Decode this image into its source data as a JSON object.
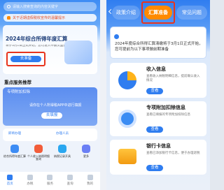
{
  "left": {
    "search_placeholder": "请输入搜索查询的内容关键字",
    "notice": "关于近期虚假税收宣传的温馨提示",
    "hero": {
      "title": "2024年综合所得年度汇算",
      "subtitle": "将于3月1日正式开始，您可进入申报页面提前准备",
      "button": "去准备"
    },
    "section_title": "重点服务推荐",
    "promo_title": "专项附加扣除",
    "promo_text": "请你在个人所得税APP中进行填报",
    "promo_button": "去填报",
    "mid_labels": [
      "即将办理",
      "办理人员"
    ],
    "grid": [
      "综合所得年度汇算",
      "个人收入纳税明细查询",
      "纳税记录开具",
      "更多"
    ],
    "bottom_nav": [
      "首页",
      "办税",
      "服务",
      "查询",
      "我的"
    ]
  },
  "right": {
    "tabs": [
      "政策介绍",
      "汇算准备",
      "常见问题"
    ],
    "banner": "2024年度综合所得汇算清缴将于3月1日正式开始，您可提前为以下事项做前期准备",
    "cards": [
      {
        "title": "收入信息",
        "desc": "查看收入纳税明细信息，提前确认收入情况",
        "button": "查看"
      },
      {
        "title": "专项附加扣除信息",
        "desc": "查看已填报的专项附加扣除信息",
        "button": "查看"
      },
      {
        "title": "银行卡信息",
        "desc": "查看已添加银行卡信息，便于办理退税",
        "button": "查看"
      }
    ]
  },
  "colors": {
    "primary": "#2f7df0",
    "highlight": "#e8341c",
    "accent_orange": "#ff8a00"
  }
}
